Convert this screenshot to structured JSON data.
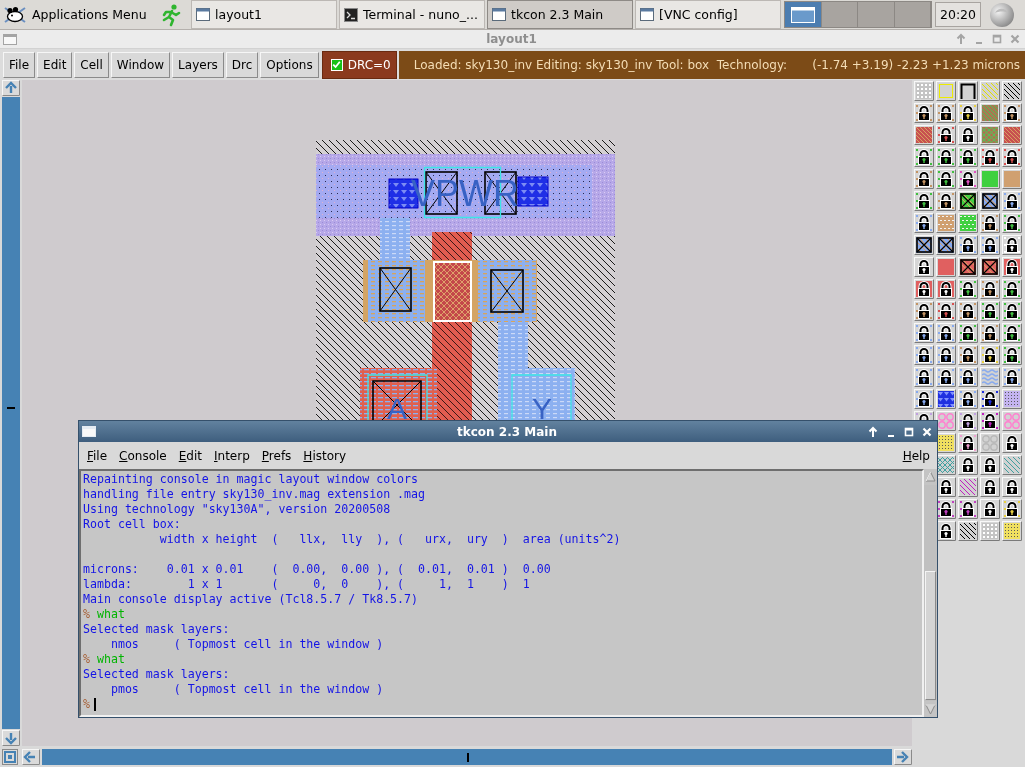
{
  "taskbar": {
    "app_menu": "Applications Menu",
    "tasks": [
      {
        "label": "layout1",
        "kind": "window",
        "selected": false
      },
      {
        "label": "Terminal - nuno_...",
        "kind": "terminal",
        "selected": false
      },
      {
        "label": "tkcon 2.3 Main",
        "kind": "window",
        "selected": true
      },
      {
        "label": "[VNC config]",
        "kind": "window",
        "selected": false
      }
    ],
    "workspaces": [
      {
        "selected": true
      },
      {
        "selected": false
      },
      {
        "selected": false
      },
      {
        "selected": false
      }
    ],
    "clock": "20:20"
  },
  "layout_window": {
    "title": "layout1",
    "active": false,
    "menu": [
      "File",
      "Edit",
      "Cell",
      "Window",
      "Layers",
      "Drc",
      "Options"
    ],
    "drc": {
      "label": "DRC=0",
      "checked": true
    },
    "status": "Loaded: sky130_inv Editing: sky130_inv Tool: box  Technology:",
    "cursor_position": "(-1.74 +3.19) -2.23 +1.23 microns",
    "layout": {
      "power_rail_label": "VPWR",
      "left_pad_label": "A",
      "right_pad_label": "Y"
    }
  },
  "console_window": {
    "title": "tkcon 2.3 Main",
    "active": true,
    "menu": [
      "File",
      "Console",
      "Edit",
      "Interp",
      "Prefs",
      "History"
    ],
    "help_menu": "Help",
    "lines": [
      {
        "kind": "output",
        "text": "Repainting console in magic layout window colors"
      },
      {
        "kind": "output",
        "text": "handling file entry sky130_inv.mag extension .mag"
      },
      {
        "kind": "output",
        "text": "Using technology \"sky130A\", version 20200508"
      },
      {
        "kind": "output",
        "text": "Root cell box:"
      },
      {
        "kind": "output",
        "text": "           width x height  (   llx,  lly  ), (   urx,  ury  )  area (units^2)"
      },
      {
        "kind": "blank"
      },
      {
        "kind": "output",
        "text": "microns:    0.01 x 0.01    (  0.00,  0.00 ), (  0.01,  0.01 )  0.00"
      },
      {
        "kind": "output",
        "text": "lambda:        1 x 1       (     0,  0    ), (     1,  1    )  1"
      },
      {
        "kind": "output",
        "text": "Main console display active (Tcl8.5.7 / Tk8.5.7)"
      },
      {
        "kind": "command",
        "prompt": "%",
        "text": "what"
      },
      {
        "kind": "output",
        "text": "Selected mask layers:"
      },
      {
        "kind": "output",
        "text": "    nmos     ( Topmost cell in the window )"
      },
      {
        "kind": "command",
        "prompt": "%",
        "text": "what"
      },
      {
        "kind": "output",
        "text": "Selected mask layers:"
      },
      {
        "kind": "output",
        "text": "    pmos     ( Topmost cell in the window )"
      },
      {
        "kind": "input",
        "prompt": "%"
      }
    ]
  }
}
